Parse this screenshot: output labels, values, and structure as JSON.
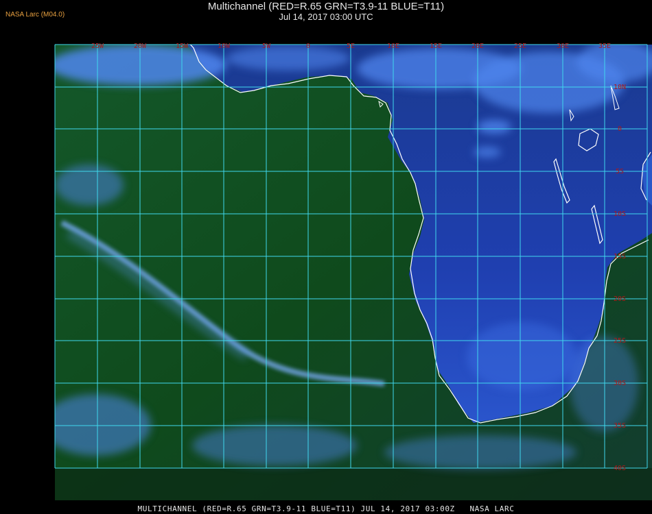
{
  "header": {
    "credit": "NASA Larc (M04.0)",
    "title": "Multichannel (RED=R.65 GRN=T3.9-11 BLUE=T11)",
    "subtitle": "Jul 14, 2017 03:00 UTC"
  },
  "footer": {
    "caption": "MULTICHANNEL (RED=R.65 GRN=T3.9-11 BLUE=T11) JUL 14, 2017 03:00Z   NASA LARC"
  },
  "map": {
    "longitude_labels": [
      "25W",
      "20W",
      "15W",
      "10W",
      "5W",
      "0",
      "5E",
      "10E",
      "15E",
      "20E",
      "25E",
      "30E",
      "35E"
    ],
    "latitude_labels": [
      "10N",
      "0",
      "5S",
      "10S",
      "15S",
      "20S",
      "25S",
      "30S",
      "35S",
      "40S"
    ],
    "colors": {
      "ocean": "#0f4a1c",
      "land": "#1f3fb0",
      "cloud": "#4f86ee",
      "grid": "#40d8ee",
      "coast": "#ffffff",
      "grid_label": "#b01818"
    }
  }
}
